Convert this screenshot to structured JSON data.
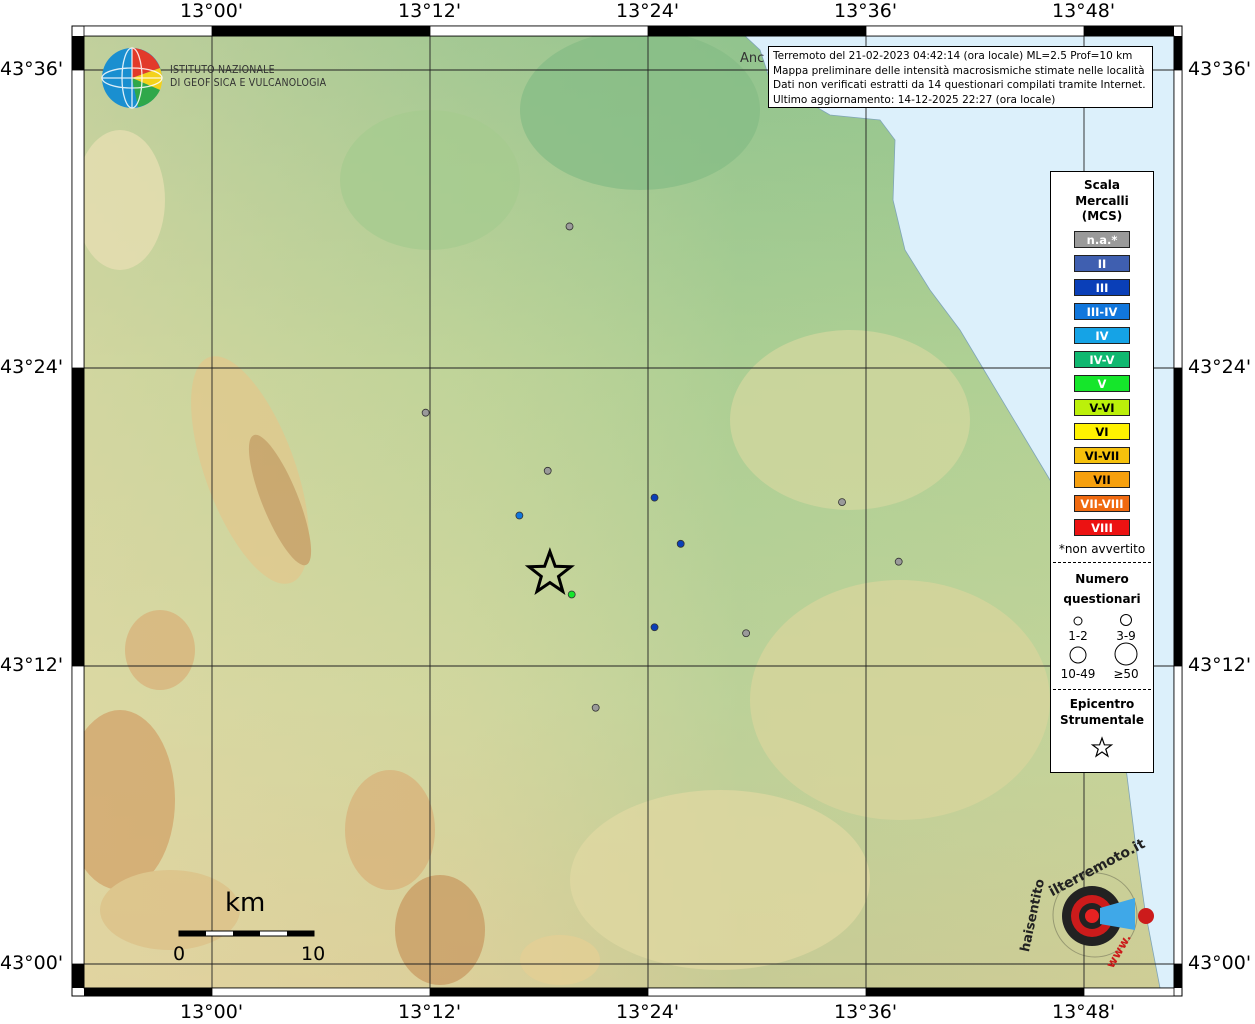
{
  "coords": {
    "top": [
      "13°00'",
      "13°12'",
      "13°24'",
      "13°36'",
      "13°48'"
    ],
    "bottom": [
      "13°00'",
      "13°12'",
      "13°24'",
      "13°36'",
      "13°48'"
    ],
    "left": [
      "43°36'",
      "43°24'",
      "43°12'",
      "43°00'"
    ],
    "right": [
      "43°36'",
      "43°24'",
      "43°12'",
      "43°00'"
    ]
  },
  "logo": {
    "line1": "ISTITUTO NAZIONALE",
    "line2": "DI GEOFISICA E VULCANOLOGIA"
  },
  "city_label": "Anc",
  "info": {
    "line1": "Terremoto del 21-02-2023 04:42:14 (ora locale) ML=2.5 Prof=10 km",
    "line2": "Mappa preliminare delle intensità macrosismiche stimate nelle località",
    "line3": "Dati non verificati estratti da 14 questionari compilati tramite Internet.",
    "line4": "Ultimo aggiornamento: 14-12-2025 22:27 (ora locale)"
  },
  "legend": {
    "title1": "Scala",
    "title2": "Mercalli",
    "title3": "(MCS)",
    "classes": [
      {
        "label": "n.a.*",
        "color": "#9a9a9a"
      },
      {
        "label": "II",
        "color": "#3f5fb0"
      },
      {
        "label": "III",
        "color": "#0a3fb8"
      },
      {
        "label": "III-IV",
        "color": "#1177dd"
      },
      {
        "label": "IV",
        "color": "#15a3e6"
      },
      {
        "label": "IV-V",
        "color": "#10b870"
      },
      {
        "label": "V",
        "color": "#15e62b"
      },
      {
        "label": "V-VI",
        "color": "#bbf00a"
      },
      {
        "label": "VI",
        "color": "#fff200"
      },
      {
        "label": "VI-VII",
        "color": "#f6c10c"
      },
      {
        "label": "VII",
        "color": "#f6a00e"
      },
      {
        "label": "VII-VIII",
        "color": "#f06a10"
      },
      {
        "label": "VIII",
        "color": "#ec1212"
      }
    ],
    "note": "*non avvertito",
    "count_title1": "Numero",
    "count_title2": "questionari",
    "counts": [
      "1-2",
      "3-9",
      "10-49",
      "≥50"
    ],
    "epi_title1": "Epicentro",
    "epi_title2": "Strumentale"
  },
  "scale": {
    "unit": "km",
    "start": "0",
    "end": "10"
  },
  "watermark": {
    "text1": "haisentito",
    "text2": "ilterremoto.it",
    "text3": "www."
  },
  "points": [
    {
      "lat": 43.495,
      "lon": 13.328,
      "intensity": "n.a.*"
    },
    {
      "lat": 43.37,
      "lon": 13.196,
      "intensity": "n.a.*"
    },
    {
      "lat": 43.331,
      "lon": 13.308,
      "intensity": "n.a.*"
    },
    {
      "lat": 43.301,
      "lon": 13.282,
      "intensity": "III-IV"
    },
    {
      "lat": 43.313,
      "lon": 13.406,
      "intensity": "III"
    },
    {
      "lat": 43.282,
      "lon": 13.43,
      "intensity": "III"
    },
    {
      "lat": 43.226,
      "lon": 13.406,
      "intensity": "III"
    },
    {
      "lat": 43.248,
      "lon": 13.33,
      "intensity": "V"
    },
    {
      "lat": 43.31,
      "lon": 13.578,
      "intensity": "n.a.*"
    },
    {
      "lat": 43.27,
      "lon": 13.63,
      "intensity": "n.a.*"
    },
    {
      "lat": 43.222,
      "lon": 13.49,
      "intensity": "n.a.*"
    },
    {
      "lat": 43.172,
      "lon": 13.352,
      "intensity": "n.a.*"
    }
  ],
  "epicenter": {
    "lat": 43.262,
    "lon": 13.31
  }
}
